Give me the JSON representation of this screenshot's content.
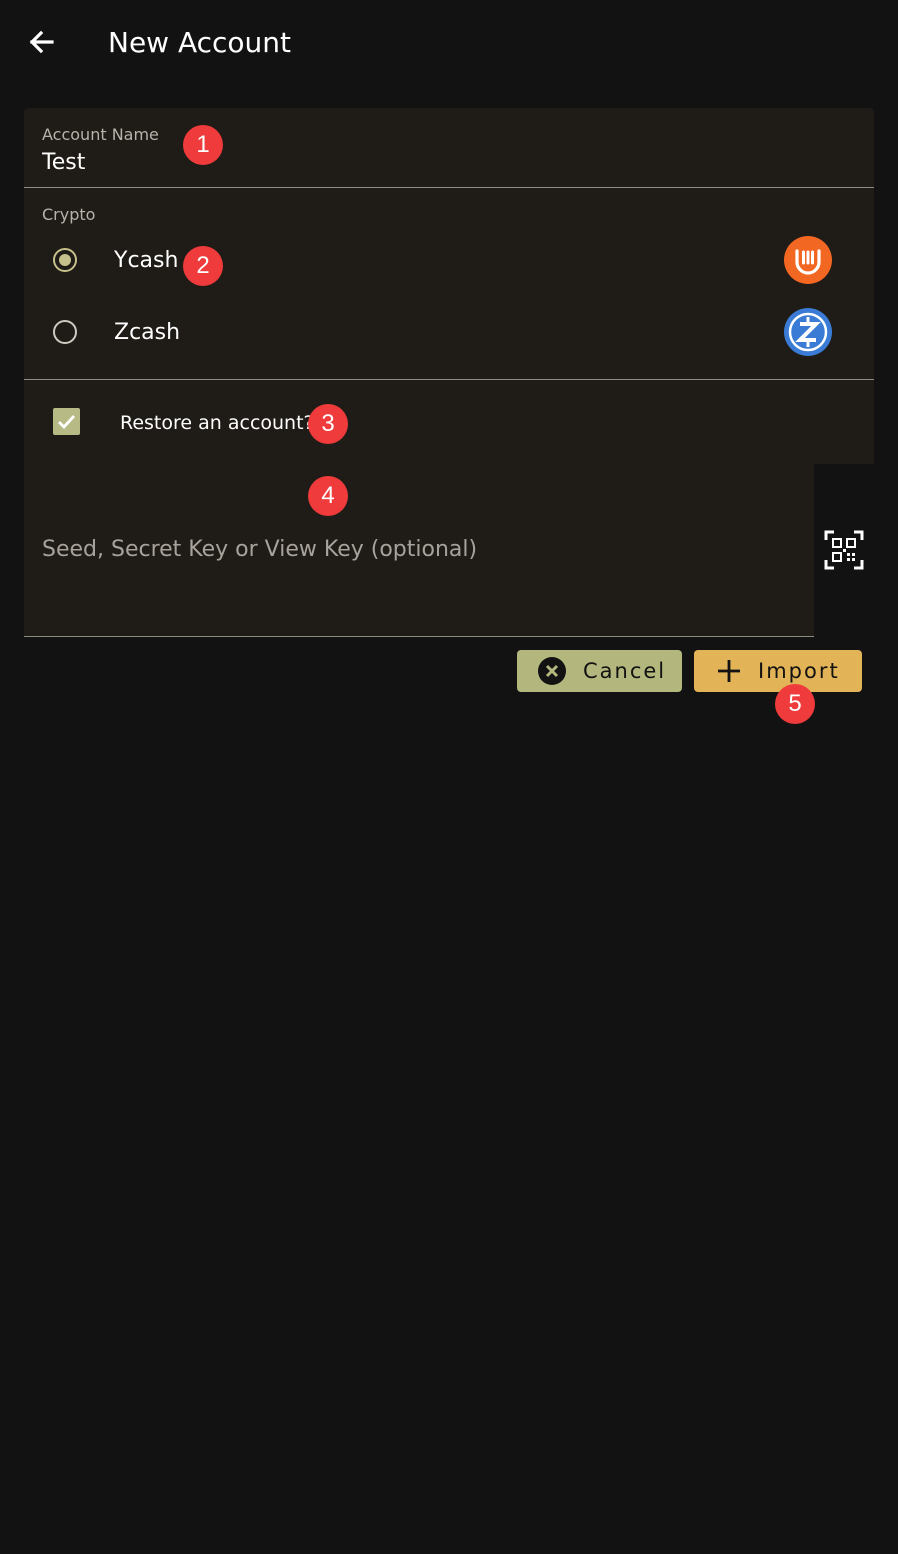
{
  "app_bar": {
    "title": "New Account",
    "back_icon": "arrow-left-icon"
  },
  "form": {
    "account_name": {
      "label": "Account Name",
      "value": "Test"
    },
    "crypto": {
      "label": "Crypto",
      "options": [
        {
          "label": "Ycash",
          "selected": true,
          "icon": "ycash-logo-icon",
          "color": "#f26822"
        },
        {
          "label": "Zcash",
          "selected": false,
          "icon": "zcash-logo-icon",
          "color": "#3a7bd5"
        }
      ]
    },
    "restore": {
      "label": "Restore an account?",
      "checked": true
    },
    "seed": {
      "placeholder": "Seed, Secret Key or View Key (optional)",
      "value": "",
      "scan_icon": "qr-scan-icon"
    }
  },
  "actions": {
    "cancel_label": "Cancel",
    "import_label": "Import"
  },
  "markers": [
    "1",
    "2",
    "3",
    "4",
    "5"
  ],
  "colors": {
    "background": "#121212",
    "surface": "#1f1b16",
    "cancel_button": "#b3b77d",
    "import_button": "#e3b357",
    "accent_radio": "#c6c08a",
    "marker": "#ef3b3b"
  }
}
